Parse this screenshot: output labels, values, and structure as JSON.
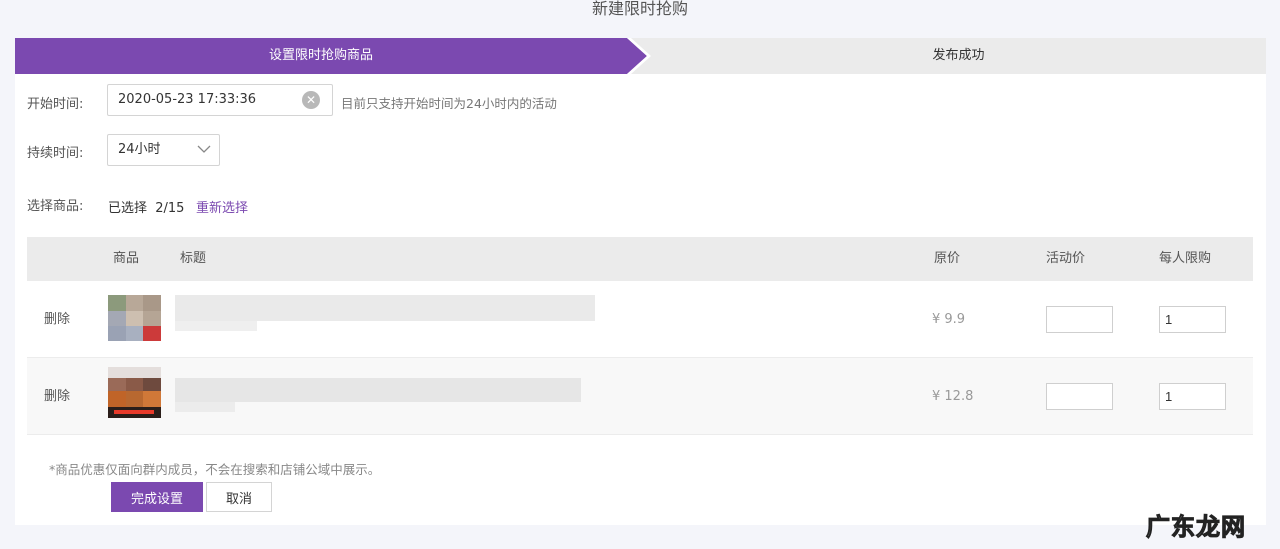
{
  "page_title": "新建限时抢购",
  "steps": [
    {
      "label": "设置限时抢购商品",
      "active": true
    },
    {
      "label": "发布成功",
      "active": false
    }
  ],
  "form": {
    "start_time_label": "开始时间:",
    "start_time_value": "2020-05-23 17:33:36",
    "start_time_hint": "目前只支持开始时间为24小时内的活动",
    "duration_label": "持续时间:",
    "duration_value": "24小时",
    "select_goods_label": "选择商品:",
    "selected_count": "已选择  2/15",
    "reselect_link": "重新选择"
  },
  "table": {
    "headers": {
      "goods": "商品",
      "title": "标题",
      "orig_price": "原价",
      "activity_price": "活动价",
      "limit": "每人限购"
    },
    "rows": [
      {
        "delete": "删除",
        "price": "¥ 9.9",
        "activity_price": "",
        "limit": "1"
      },
      {
        "delete": "删除",
        "price": "¥ 12.8",
        "activity_price": "",
        "limit": "1"
      }
    ]
  },
  "note": "*商品优惠仅面向群内成员，不会在搜索和店铺公域中展示。",
  "buttons": {
    "finish": "完成设置",
    "cancel": "取消"
  },
  "watermark": "广东龙网",
  "colors": {
    "accent": "#7b49b0",
    "header_bg": "#ebebeb",
    "page_bg": "#f4f5fa"
  }
}
